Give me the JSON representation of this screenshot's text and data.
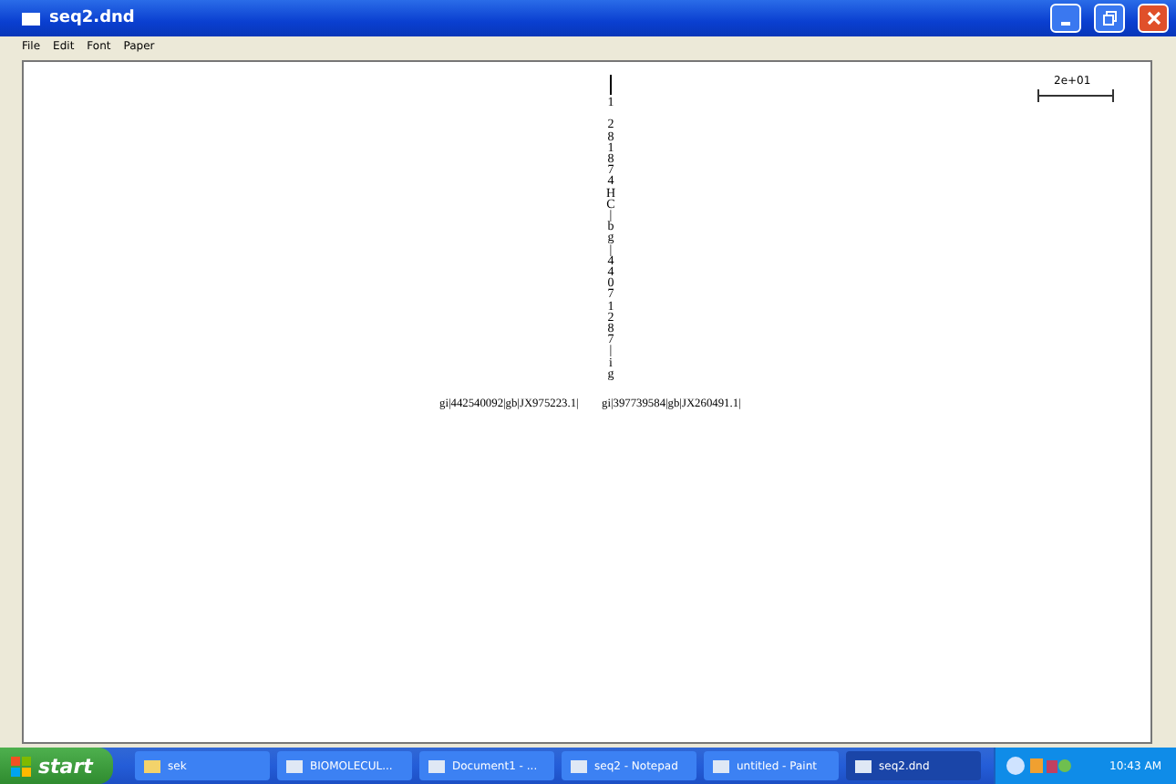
{
  "window": {
    "title": "seq2.dnd"
  },
  "menu": [
    "File",
    "Edit",
    "Font",
    "Paper"
  ],
  "tree": {
    "vertical_label": "1 281874HC|bg|44071287|ig",
    "left_leaf": "gi|442540092|gb|JX975223.1|",
    "right_leaf": "gi|397739584|gb|JX260491.1|",
    "scale_label": "2e+01"
  },
  "taskbar": {
    "start": "start",
    "tasks": [
      {
        "label": "sek",
        "selected": false
      },
      {
        "label": "BIOMOLECUL...",
        "selected": false
      },
      {
        "label": "Document1 - ...",
        "selected": false
      },
      {
        "label": "seq2 - Notepad",
        "selected": false
      },
      {
        "label": "untitled - Paint",
        "selected": false
      },
      {
        "label": "seq2.dnd",
        "selected": true
      }
    ],
    "clock": "10:43 AM"
  }
}
